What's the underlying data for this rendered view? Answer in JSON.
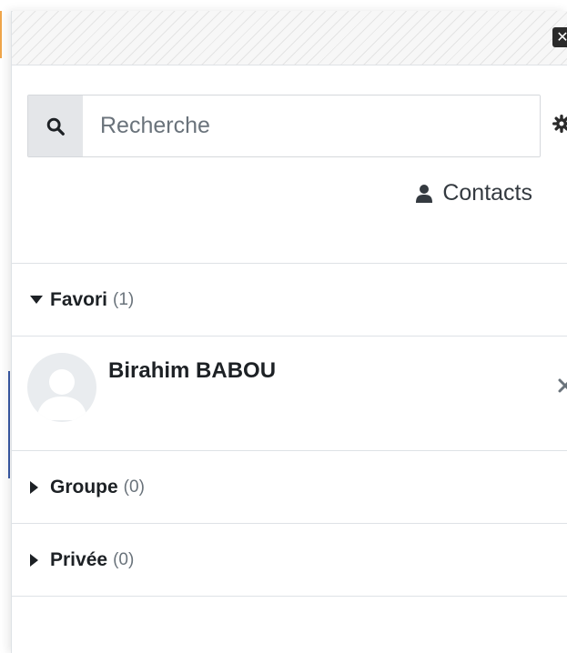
{
  "drawer": {
    "close_icon": "close-icon",
    "search": {
      "placeholder": "Recherche",
      "icon": "search-icon"
    },
    "settings_icon": "gear-icon",
    "contacts_link": {
      "label": "Contacts",
      "icon": "user-icon"
    },
    "sections": [
      {
        "title": "Favori",
        "count": "(1)",
        "expanded": true,
        "items": [
          {
            "name": "Birahim BABOU"
          }
        ]
      },
      {
        "title": "Groupe",
        "count": "(0)",
        "expanded": false
      },
      {
        "title": "Privée",
        "count": "(0)",
        "expanded": false
      }
    ]
  },
  "colors": {
    "accent_orange": "#f0a64a",
    "accent_blue": "#3a5aa6",
    "border": "#dee2e6",
    "search_button_bg": "#e4e6e9"
  }
}
